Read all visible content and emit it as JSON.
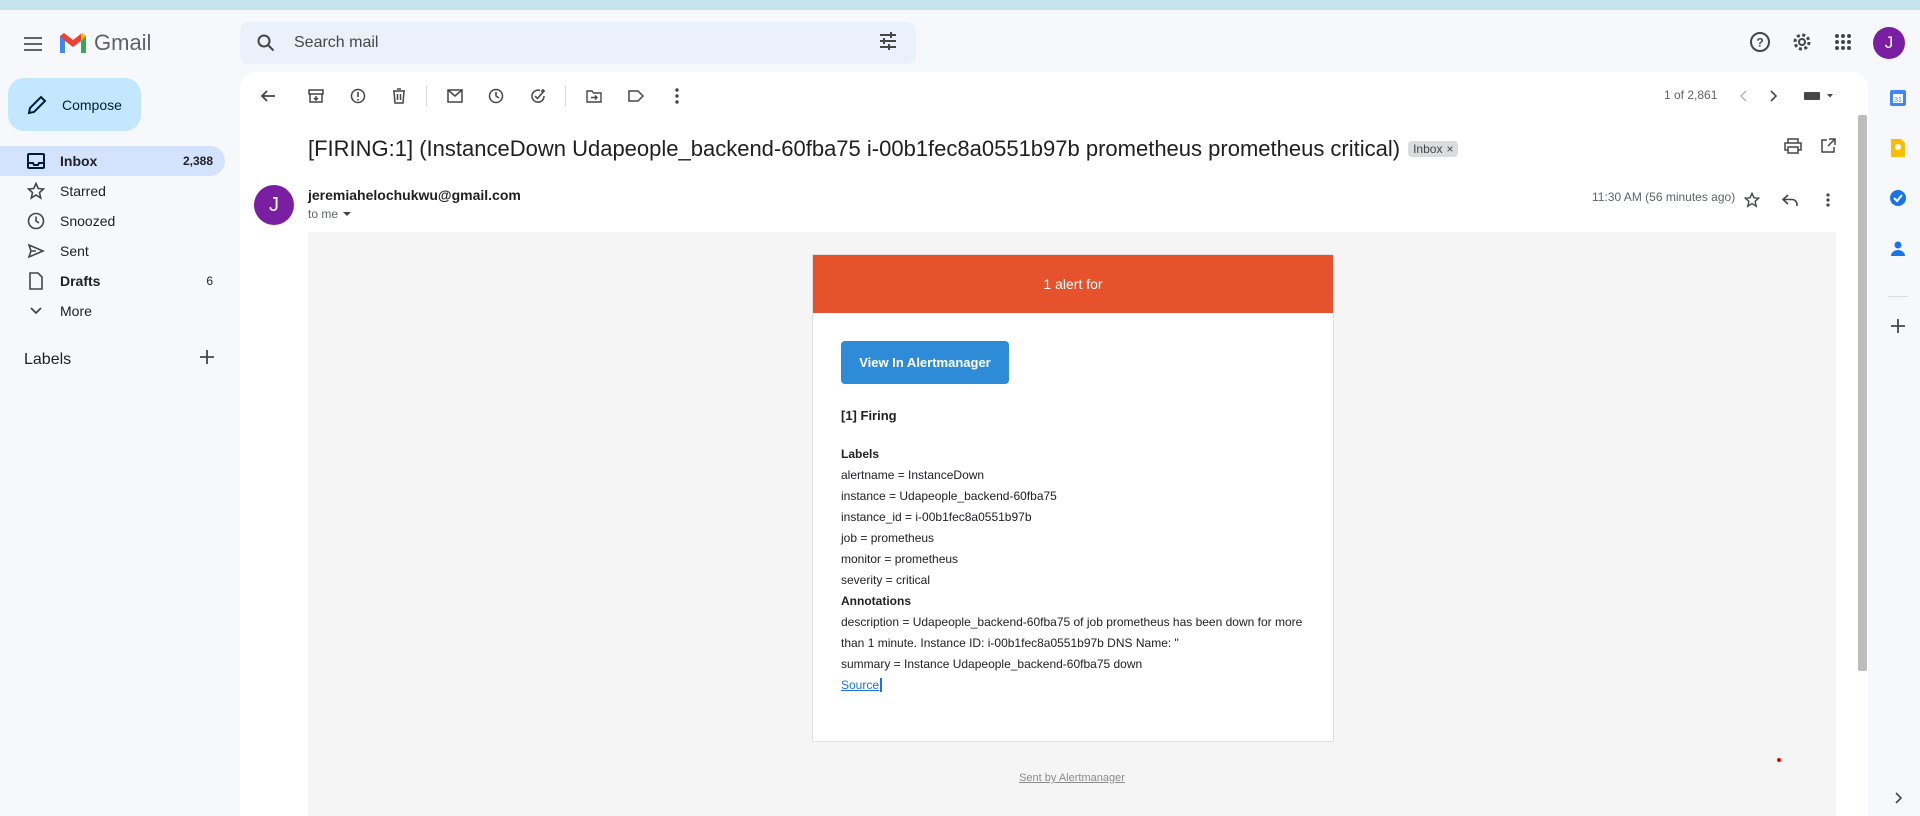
{
  "app": {
    "name": "Gmail",
    "avatar_letter": "J"
  },
  "search": {
    "placeholder": "Search mail"
  },
  "compose_label": "Compose",
  "nav": [
    {
      "label": "Inbox",
      "count": "2,388",
      "icon": "inbox-icon"
    },
    {
      "label": "Starred",
      "count": "",
      "icon": "star-icon"
    },
    {
      "label": "Snoozed",
      "count": "",
      "icon": "clock-icon"
    },
    {
      "label": "Sent",
      "count": "",
      "icon": "send-icon"
    },
    {
      "label": "Drafts",
      "count": "6",
      "icon": "draft-icon"
    },
    {
      "label": "More",
      "count": "",
      "icon": "chevron-down-icon"
    }
  ],
  "labels_header": "Labels",
  "pager": "1 of 2,861",
  "message": {
    "subject": "[FIRING:1] (InstanceDown Udapeople_backend-60fba75 i-00b1fec8a0551b97b prometheus prometheus critical)",
    "tag": "Inbox",
    "sender": "jeremiahelochukwu@gmail.com",
    "to": "to me",
    "time": "11:30 AM (56 minutes ago)",
    "sender_avatar_letter": "J"
  },
  "alert": {
    "header": "1 alert for",
    "button": "View In Alertmanager",
    "firing": "[1] Firing",
    "labels_title": "Labels",
    "labels": [
      "alertname = InstanceDown",
      "instance = Udapeople_backend-60fba75",
      "instance_id = i-00b1fec8a0551b97b",
      "job = prometheus",
      "monitor = prometheus",
      "severity = critical"
    ],
    "annotations_title": "Annotations",
    "annotations": [
      "description = Udapeople_backend-60fba75 of job prometheus has been down for more than 1 minute. Instance ID: i-00b1fec8a0551b97b DNS Name: \"",
      "summary = Instance Udapeople_backend-60fba75 down"
    ],
    "source": "Source",
    "footer": "Sent by Alertmanager"
  },
  "colors": {
    "alert_header": "#e6522c",
    "button": "#2e8bd8",
    "accent": "#d3e3fd"
  }
}
